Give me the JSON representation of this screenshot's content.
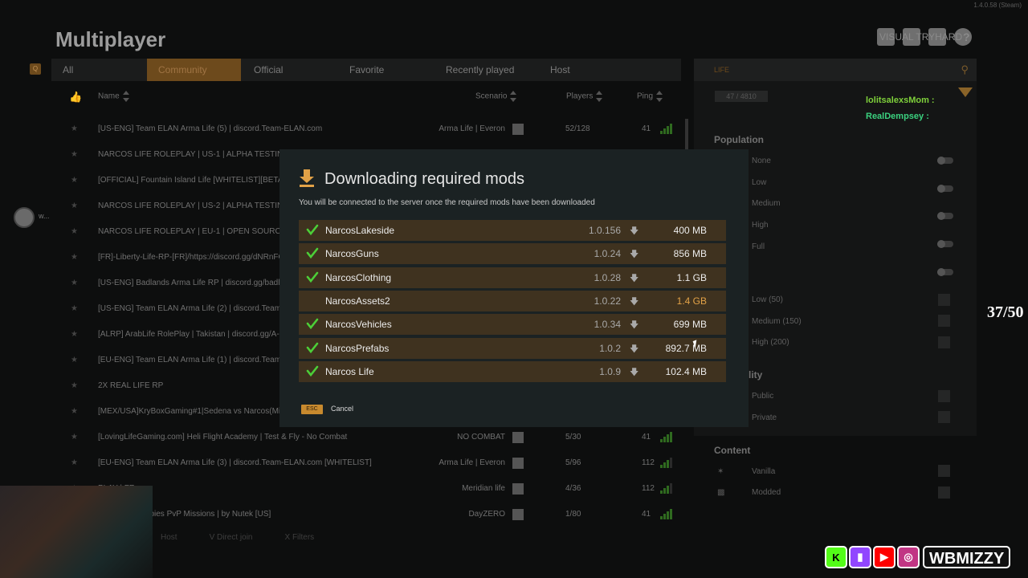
{
  "app": {
    "title": "Multiplayer",
    "version": "1.4.0.58 (Steam)",
    "user": "VISUAL TRYHARD",
    "help": "?"
  },
  "tabs": {
    "left_key": "Q",
    "right_key": "E",
    "items": [
      {
        "label": "All"
      },
      {
        "label": "Community",
        "active": true
      },
      {
        "label": "Official"
      },
      {
        "label": "Favorite"
      },
      {
        "label": "Recently played"
      },
      {
        "label": "Host"
      }
    ]
  },
  "columns": {
    "name": "Name",
    "scenario": "Scenario",
    "players": "Players",
    "ping": "Ping"
  },
  "servers": [
    {
      "name": "[US-ENG] Team ELAN Arma Life (5) | discord.Team-ELAN.com",
      "scenario": "Arma Life | Everon",
      "players": "52/128",
      "ping": "41",
      "ping_level": 4
    },
    {
      "name": "NARCOS LIFE ROLEPLAY | US-1 | ALPHA TESTING | di",
      "scenario": "",
      "players": "",
      "ping": "",
      "ping_level": 0
    },
    {
      "name": "[OFFICIAL] Fountain Island Life [WHITELIST][BETA]",
      "scenario": "",
      "players": "",
      "ping": "",
      "ping_level": 0
    },
    {
      "name": "NARCOS LIFE ROLEPLAY | US-2 | ALPHA TESTING | di",
      "scenario": "",
      "players": "",
      "ping": "",
      "ping_level": 0
    },
    {
      "name": "NARCOS LIFE ROLEPLAY | EU-1 | OPEN SOURCE 0.1.1",
      "scenario": "",
      "players": "",
      "ping": "",
      "ping_level": 0
    },
    {
      "name": "[FR]-Liberty-Life-RP-[FR]/https://discord.gg/dNRnFGw",
      "scenario": "",
      "players": "",
      "ping": "",
      "ping_level": 0
    },
    {
      "name": "[US-ENG] Badlands Arma Life RP | discord.gg/badland",
      "scenario": "",
      "players": "",
      "ping": "",
      "ping_level": 0
    },
    {
      "name": "[US-ENG] Team ELAN Arma Life (2) | discord.Team-EL",
      "scenario": "",
      "players": "",
      "ping": "",
      "ping_level": 0
    },
    {
      "name": "[ALRP] ArabLife RolePlay | Takistan | discord.gg/A-RP",
      "scenario": "",
      "players": "",
      "ping": "",
      "ping_level": 0
    },
    {
      "name": "[EU-ENG] Team ELAN Arma Life (1) | discord.Team-EL",
      "scenario": "",
      "players": "",
      "ping": "",
      "ping_level": 0
    },
    {
      "name": "2X REAL LIFE RP",
      "scenario": "",
      "players": "",
      "ping": "",
      "ping_level": 0
    },
    {
      "name": "[MEX/USA]KryBoxGaming#1|Sedena vs Narcos(Milsim",
      "scenario": "",
      "players": "",
      "ping": "",
      "ping_level": 0
    },
    {
      "name": "[LovingLifeGaming.com] Heli Flight Academy | Test & Fly - No Combat",
      "scenario": "NO COMBAT",
      "players": "5/30",
      "ping": "41",
      "ping_level": 4
    },
    {
      "name": "[EU-ENG] Team ELAN Arma Life (3) | discord.Team-ELAN.com [WHITELIST]",
      "scenario": "Arma Life | Everon",
      "players": "5/96",
      "ping": "112",
      "ping_level": 3
    },
    {
      "name": "PLAY | FR",
      "scenario": "Meridian life",
      "players": "4/36",
      "ping": "112",
      "ping_level": 3
    },
    {
      "name": "s Traders Zombies PvP Missions | by Nutek [US]",
      "scenario": "DayZERO",
      "players": "1/80",
      "ping": "41",
      "ping_level": 4
    }
  ],
  "search": {
    "query": "LIFE"
  },
  "result_count": "47 / 4810",
  "filters": {
    "population_title": "Population",
    "population": [
      "None",
      "Low",
      "Medium",
      "High",
      "Full"
    ],
    "size": [
      "Low (50)",
      "Medium (150)",
      "High (200)"
    ],
    "visibility_title": "lity",
    "visibility": [
      "Public",
      "Private"
    ],
    "content_title": "Content",
    "content": [
      "Vanilla",
      "Modded"
    ]
  },
  "chat": [
    {
      "user": "lolitsalexsMom :",
      "color": "#7fd13b"
    },
    {
      "user": "RealDempsey :",
      "color": "#3bd17f"
    }
  ],
  "overlay_counter": "37/50",
  "avatar_label": "w...",
  "modal": {
    "title": "Downloading required mods",
    "subtitle": "You will be connected to the server once the required mods have been downloaded",
    "mods": [
      {
        "name": "NarcosLakeside",
        "version": "1.0.156",
        "size": "400 MB",
        "done": true
      },
      {
        "name": "NarcosGuns",
        "version": "1.0.24",
        "size": "856 MB",
        "done": true
      },
      {
        "name": "NarcosClothing",
        "version": "1.0.28",
        "size": "1.1 GB",
        "done": true
      },
      {
        "name": "NarcosAssets2",
        "version": "1.0.22",
        "size": "1.4 GB",
        "done": false
      },
      {
        "name": "NarcosVehicles",
        "version": "1.0.34",
        "size": "699 MB",
        "done": true
      },
      {
        "name": "NarcosPrefabs",
        "version": "1.0.2",
        "size": "892.7 MB",
        "done": true
      },
      {
        "name": "Narcos Life",
        "version": "1.0.9",
        "size": "102.4 MB",
        "done": true
      }
    ],
    "esc_key": "ESC",
    "cancel": "Cancel"
  },
  "bottom_hints": [
    "Host",
    "Direct join",
    "Filters"
  ],
  "bottom_keys": [
    "",
    "V",
    "X"
  ],
  "socials": {
    "icons": [
      "kick-icon",
      "twitch-icon",
      "youtube-icon",
      "instagram-icon"
    ],
    "handle": "WBMIZZY"
  },
  "colors": {
    "accent": "#c88a2e",
    "check": "#4ccf38",
    "pending": "#e2a247",
    "modal_row": "#3f321f"
  }
}
